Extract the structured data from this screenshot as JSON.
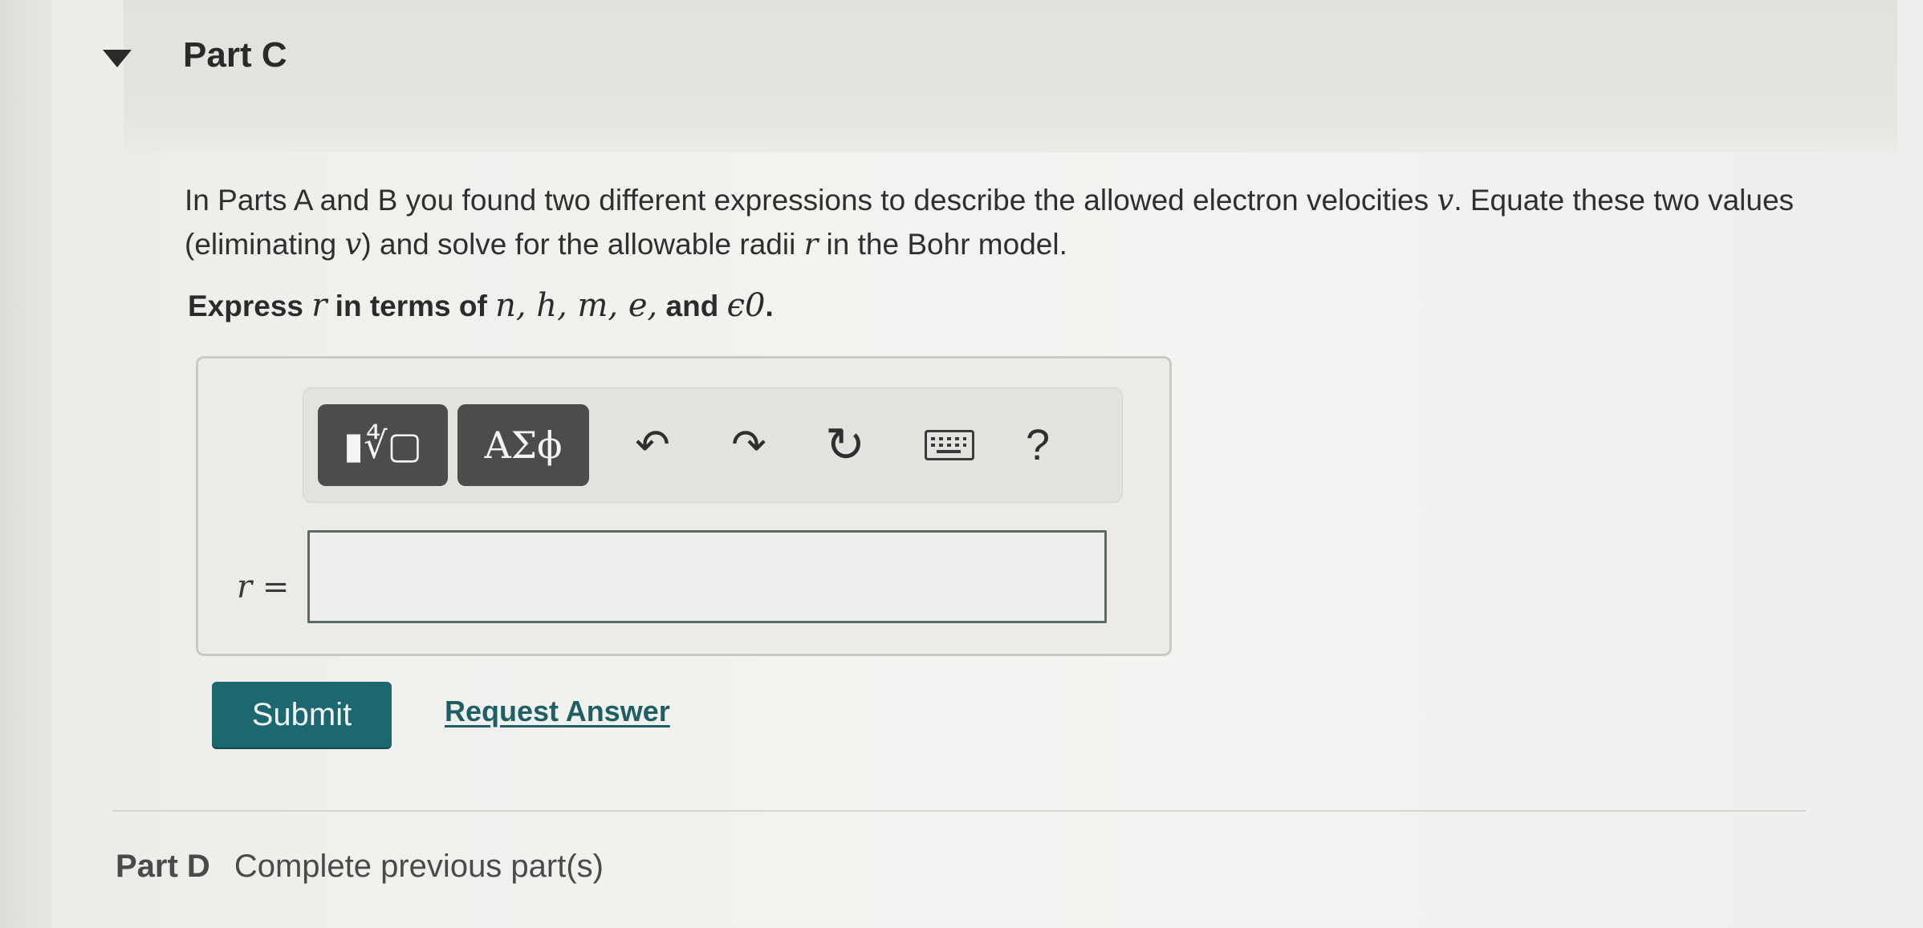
{
  "part": {
    "title": "Part C"
  },
  "question": {
    "text_1": "In Parts A and B you found two different expressions to describe the allowed electron velocities ",
    "var_v": "v",
    "text_2": ". Equate these two values (eliminating ",
    "var_v2": "v",
    "text_3": ") and solve for the allowable radii ",
    "var_r": "r",
    "text_4": " in the Bohr model."
  },
  "instruction": {
    "prefix": "Express ",
    "var_r": "r",
    "middle": " in terms of ",
    "vars": "n, h, m, e,",
    "and": " and ",
    "eps": "ϵ0",
    "suffix": "."
  },
  "toolbar": {
    "templates_label": "▮∜▢",
    "greek_label": "ΑΣϕ",
    "undo_glyph": "↶",
    "redo_glyph": "↷",
    "reset_glyph": "↻",
    "help_label": "?"
  },
  "answer": {
    "variable_label": "r =",
    "value": ""
  },
  "actions": {
    "submit_label": "Submit",
    "request_label": "Request Answer"
  },
  "next_part": {
    "label": "Part D",
    "status": "Complete previous part(s)"
  },
  "colors": {
    "submit_bg": "#1d6770",
    "link": "#1e5f66",
    "toolbar_dark": "#4c4c4c"
  }
}
